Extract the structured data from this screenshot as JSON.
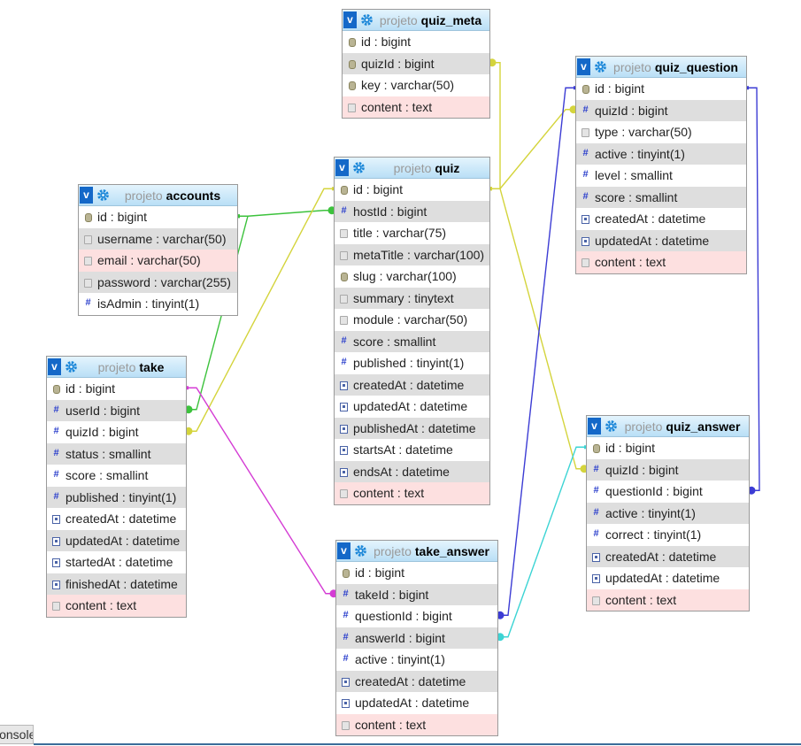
{
  "tables": [
    {
      "id": "quiz_meta",
      "db": "projeto",
      "name": "quiz_meta",
      "columns": [
        {
          "text": "id : bigint",
          "icon": "key"
        },
        {
          "text": "quizId : bigint",
          "icon": "key"
        },
        {
          "text": "key : varchar(50)",
          "icon": "key"
        },
        {
          "text": "content : text",
          "icon": "string"
        }
      ]
    },
    {
      "id": "quiz_question",
      "db": "projeto",
      "name": "quiz_question",
      "columns": [
        {
          "text": "id : bigint",
          "icon": "key"
        },
        {
          "text": "quizId : bigint",
          "icon": "numeric"
        },
        {
          "text": "type : varchar(50)",
          "icon": "string"
        },
        {
          "text": "active : tinyint(1)",
          "icon": "numeric"
        },
        {
          "text": "level : smallint",
          "icon": "numeric"
        },
        {
          "text": "score : smallint",
          "icon": "numeric"
        },
        {
          "text": "createdAt : datetime",
          "icon": "datetime"
        },
        {
          "text": "updatedAt : datetime",
          "icon": "datetime"
        },
        {
          "text": "content : text",
          "icon": "string"
        }
      ]
    },
    {
      "id": "quiz",
      "db": "projeto",
      "name": "quiz",
      "columns": [
        {
          "text": "id : bigint",
          "icon": "key"
        },
        {
          "text": "hostId : bigint",
          "icon": "numeric"
        },
        {
          "text": "title : varchar(75)",
          "icon": "string"
        },
        {
          "text": "metaTitle : varchar(100)",
          "icon": "string"
        },
        {
          "text": "slug : varchar(100)",
          "icon": "key"
        },
        {
          "text": "summary : tinytext",
          "icon": "string"
        },
        {
          "text": "module : varchar(50)",
          "icon": "string"
        },
        {
          "text": "score : smallint",
          "icon": "numeric"
        },
        {
          "text": "published : tinyint(1)",
          "icon": "numeric"
        },
        {
          "text": "createdAt : datetime",
          "icon": "datetime"
        },
        {
          "text": "updatedAt : datetime",
          "icon": "datetime"
        },
        {
          "text": "publishedAt : datetime",
          "icon": "datetime"
        },
        {
          "text": "startsAt : datetime",
          "icon": "datetime"
        },
        {
          "text": "endsAt : datetime",
          "icon": "datetime"
        },
        {
          "text": "content : text",
          "icon": "string"
        }
      ]
    },
    {
      "id": "accounts",
      "db": "projeto",
      "name": "accounts",
      "columns": [
        {
          "text": "id : bigint",
          "icon": "key"
        },
        {
          "text": "username : varchar(50)",
          "icon": "string"
        },
        {
          "text": "email : varchar(50)",
          "icon": "string"
        },
        {
          "text": "password : varchar(255)",
          "icon": "string"
        },
        {
          "text": "isAdmin : tinyint(1)",
          "icon": "numeric"
        }
      ]
    },
    {
      "id": "take",
      "db": "projeto",
      "name": "take",
      "columns": [
        {
          "text": "id : bigint",
          "icon": "key"
        },
        {
          "text": "userId : bigint",
          "icon": "numeric"
        },
        {
          "text": "quizId : bigint",
          "icon": "numeric"
        },
        {
          "text": "status : smallint",
          "icon": "numeric"
        },
        {
          "text": "score : smallint",
          "icon": "numeric"
        },
        {
          "text": "published : tinyint(1)",
          "icon": "numeric"
        },
        {
          "text": "createdAt : datetime",
          "icon": "datetime"
        },
        {
          "text": "updatedAt : datetime",
          "icon": "datetime"
        },
        {
          "text": "startedAt : datetime",
          "icon": "datetime"
        },
        {
          "text": "finishedAt : datetime",
          "icon": "datetime"
        },
        {
          "text": "content : text",
          "icon": "string"
        }
      ]
    },
    {
      "id": "quiz_answer",
      "db": "projeto",
      "name": "quiz_answer",
      "columns": [
        {
          "text": "id : bigint",
          "icon": "key"
        },
        {
          "text": "quizId : bigint",
          "icon": "numeric"
        },
        {
          "text": "questionId : bigint",
          "icon": "numeric"
        },
        {
          "text": "active : tinyint(1)",
          "icon": "numeric"
        },
        {
          "text": "correct : tinyint(1)",
          "icon": "numeric"
        },
        {
          "text": "createdAt : datetime",
          "icon": "datetime"
        },
        {
          "text": "updatedAt : datetime",
          "icon": "datetime"
        },
        {
          "text": "content : text",
          "icon": "string"
        }
      ]
    },
    {
      "id": "take_answer",
      "db": "projeto",
      "name": "take_answer",
      "columns": [
        {
          "text": "id : bigint",
          "icon": "key"
        },
        {
          "text": "takeId : bigint",
          "icon": "numeric"
        },
        {
          "text": "questionId : bigint",
          "icon": "numeric"
        },
        {
          "text": "answerId : bigint",
          "icon": "numeric"
        },
        {
          "text": "active : tinyint(1)",
          "icon": "numeric"
        },
        {
          "text": "createdAt : datetime",
          "icon": "datetime"
        },
        {
          "text": "updatedAt : datetime",
          "icon": "datetime"
        },
        {
          "text": "content : text",
          "icon": "string"
        }
      ]
    }
  ],
  "relations": [
    {
      "from": "accounts.id",
      "to": "quiz.hostId",
      "color": "#3cc23c"
    },
    {
      "from": "accounts.id",
      "to": "take.userId",
      "color": "#3cc23c"
    },
    {
      "from": "quiz.id",
      "to": "quiz_meta.quizId",
      "color": "#d4d43c"
    },
    {
      "from": "quiz.id",
      "to": "quiz_question.quizId",
      "color": "#d4d43c"
    },
    {
      "from": "quiz.id",
      "to": "quiz_answer.quizId",
      "color": "#d4d43c"
    },
    {
      "from": "quiz.id",
      "to": "take.quizId",
      "color": "#d4d43c"
    },
    {
      "from": "take.id",
      "to": "take_answer.takeId",
      "color": "#d43cd4"
    },
    {
      "from": "quiz_question.id",
      "to": "quiz_answer.questionId",
      "color": "#3c3cd4"
    },
    {
      "from": "quiz_question.id",
      "to": "take_answer.questionId",
      "color": "#3c3cd4"
    },
    {
      "from": "quiz_answer.id",
      "to": "take_answer.answerId",
      "color": "#3cd4d4"
    }
  ],
  "header_colors": {
    "button": "#1468c8",
    "gradient_top": "#e4f4fd",
    "gradient_bottom": "#b9dff6"
  },
  "console": {
    "label": "Console"
  }
}
